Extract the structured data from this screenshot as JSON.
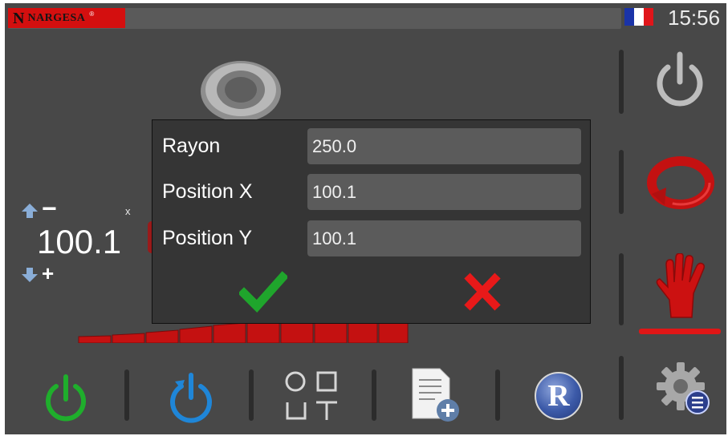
{
  "header": {
    "logo_mark": "N",
    "logo_text": "NARGESA",
    "logo_reg": "®",
    "time": "15:56",
    "language_flag": [
      "#1a33a8",
      "#ffffff",
      "#e0151a"
    ]
  },
  "axis": {
    "label": "x",
    "value": "100.1",
    "minus_label": "−",
    "plus_label": "+"
  },
  "dialog": {
    "fields": [
      {
        "label": "Rayon",
        "value": "250.0"
      },
      {
        "label": "Position X",
        "value": "100.1"
      },
      {
        "label": "Position Y",
        "value": "100.1"
      }
    ],
    "confirm_icon": "check-icon",
    "cancel_icon": "cross-icon"
  },
  "side_buttons": [
    "power-icon",
    "rotate-icon",
    "manual-hand-icon"
  ],
  "bottom_buttons": [
    "power-on-icon",
    "reset-icon",
    "shapes-icon",
    "new-document-icon",
    "r-badge-icon",
    "settings-icon"
  ],
  "r_badge_text": "R",
  "colors": {
    "accent_red": "#d40f0f",
    "ok_green": "#1fa52c",
    "cancel_red": "#e81919",
    "power_green": "#1fae2c",
    "reset_blue": "#1f86d8",
    "background": "#484848",
    "dialog": "#353535",
    "field": "#5b5b5b"
  }
}
